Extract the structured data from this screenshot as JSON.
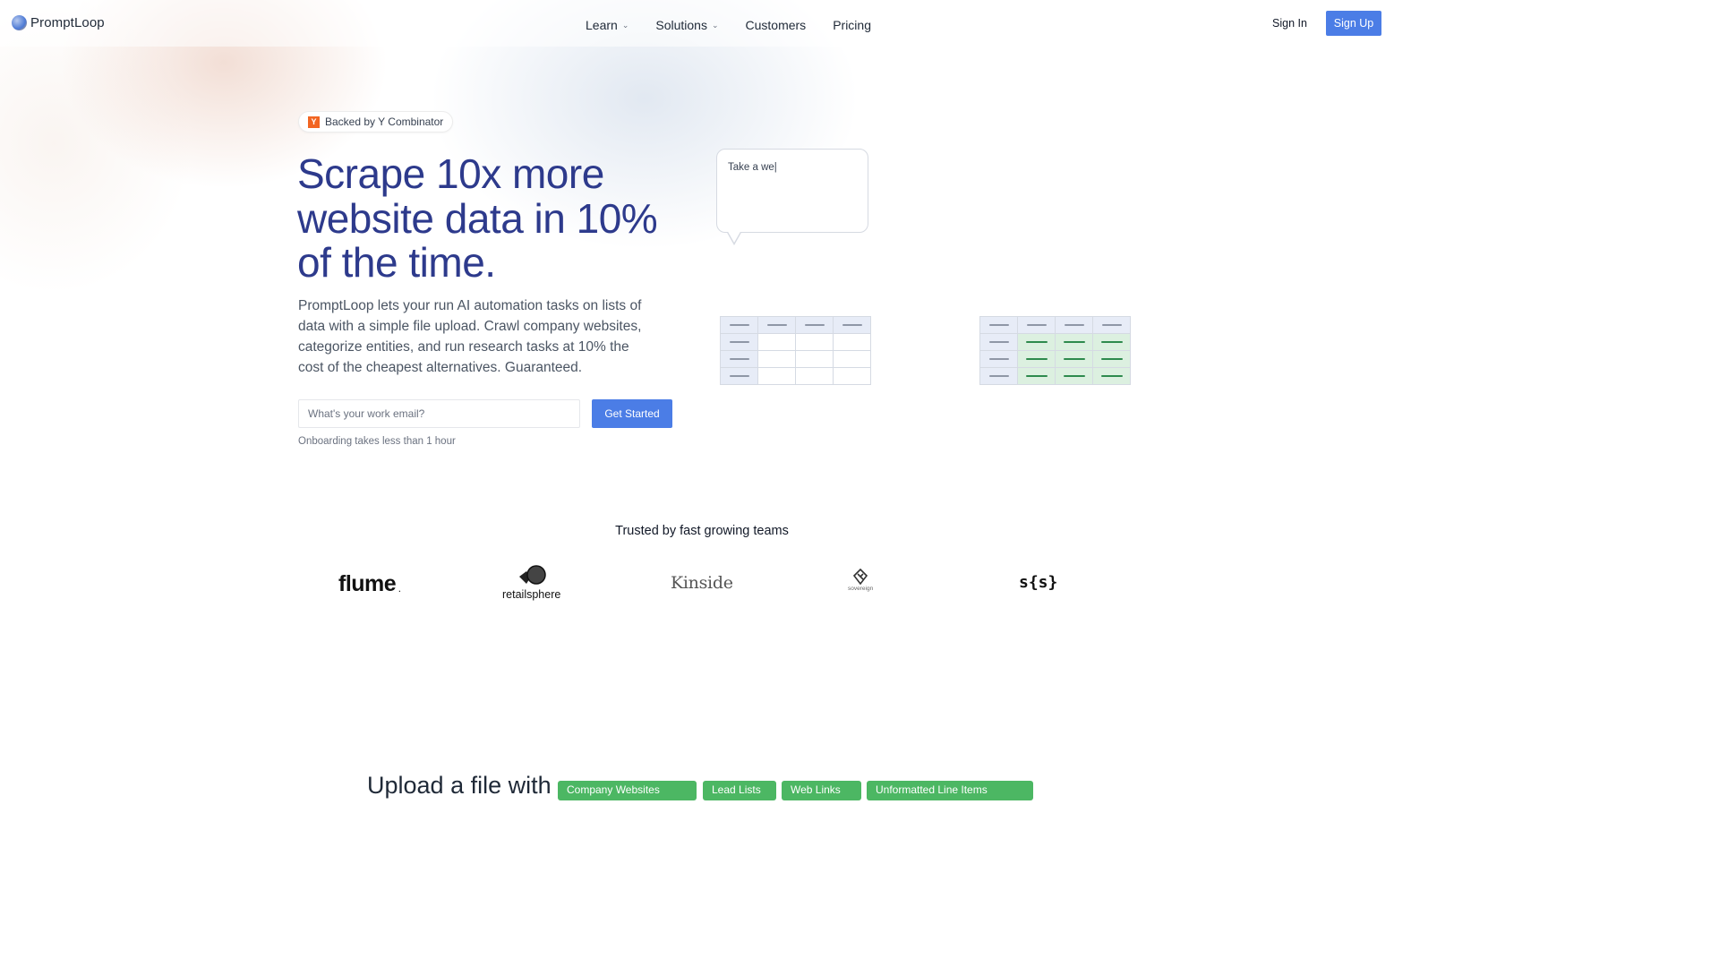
{
  "nav": {
    "brand": "PromptLoop",
    "links": [
      {
        "label": "Learn",
        "dropdown": true
      },
      {
        "label": "Solutions",
        "dropdown": true
      },
      {
        "label": "Customers",
        "dropdown": false
      },
      {
        "label": "Pricing",
        "dropdown": false
      }
    ],
    "sign_in": "Sign In",
    "sign_up": "Sign Up"
  },
  "hero": {
    "badge": {
      "icon": "Y",
      "text": "Backed by Y Combinator"
    },
    "headline": "Scrape 10x more website data in 10% of the time.",
    "subtext": "PromptLoop lets your run AI automation tasks on lists of data with a simple file upload. Crawl company websites, categorize entities, and run research tasks at 10% the cost of the cheapest alternatives. Guaranteed.",
    "email_placeholder": "What's your work email?",
    "cta": "Get Started",
    "note": "Onboarding takes less than 1 hour"
  },
  "demo": {
    "prompt_text": "Take a we|"
  },
  "trusted": {
    "title": "Trusted by fast growing teams",
    "logos": [
      "flume",
      "retailsphere",
      "Kinside",
      "sovereign",
      "s{s}"
    ]
  },
  "upload_section": {
    "title": "Upload a file with",
    "tags": [
      "Company Websites",
      "Lead Lists",
      "Web Links",
      "Unformatted Line Items"
    ]
  },
  "colors": {
    "accent": "#4b7de6",
    "headline": "#2d3a8c",
    "tag_green": "#4cb763"
  }
}
